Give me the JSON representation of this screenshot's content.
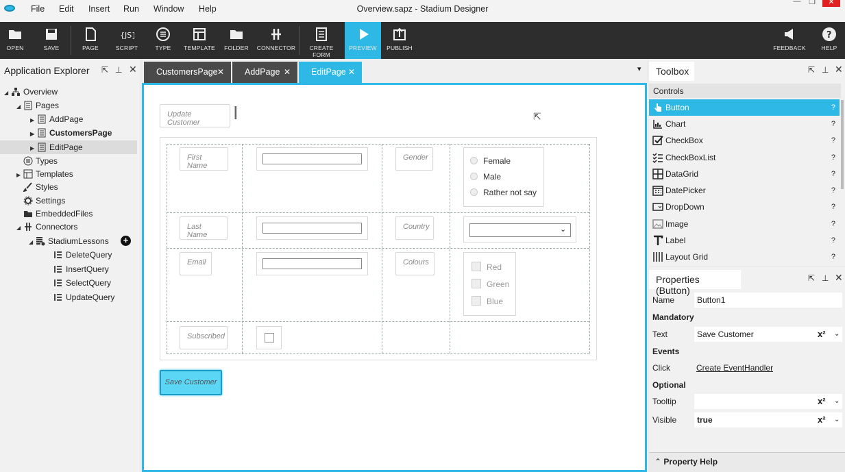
{
  "window": {
    "title": "Overview.sapz - Stadium Designer",
    "menu": [
      "File",
      "Edit",
      "Insert",
      "Run",
      "Window",
      "Help"
    ]
  },
  "toolbar": {
    "open": "OPEN",
    "save": "SAVE",
    "page": "PAGE",
    "script": "SCRIPT",
    "type": "TYPE",
    "template": "TEMPLATE",
    "folder": "FOLDER",
    "connector": "CONNECTOR",
    "create_form": "CREATE FORM",
    "preview": "PREVIEW",
    "publish": "PUBLISH",
    "feedback": "FEEDBACK",
    "help": "HELP"
  },
  "explorer": {
    "title": "Application Explorer",
    "items": {
      "overview": "Overview",
      "pages": "Pages",
      "addpage": "AddPage",
      "customerspage": "CustomersPage",
      "editpage": "EditPage",
      "types": "Types",
      "templates": "Templates",
      "styles": "Styles",
      "settings": "Settings",
      "embedded": "EmbeddedFiles",
      "connectors": "Connectors",
      "lessons": "StadiumLessons",
      "delete": "DeleteQuery",
      "insert": "InsertQuery",
      "select": "SelectQuery",
      "update": "UpdateQuery"
    }
  },
  "tabs": [
    "CustomersPage",
    "AddPage",
    "EditPage"
  ],
  "form": {
    "heading": "Update Customer",
    "first_name": "First Name",
    "gender": "Gender",
    "female": "Female",
    "male": "Male",
    "rather_not": "Rather not say",
    "last_name": "Last Name",
    "country": "Country",
    "email": "Email",
    "colours": "Colours",
    "red": "Red",
    "green": "Green",
    "blue": "Blue",
    "subscribed": "Subscribed",
    "save_button": "Save Customer"
  },
  "toolbox": {
    "title": "Toolbox",
    "section": "Controls",
    "items": [
      "Button",
      "Chart",
      "CheckBox",
      "CheckBoxList",
      "DataGrid",
      "DatePicker",
      "DropDown",
      "Image",
      "Label",
      "Layout Grid"
    ],
    "help": "?"
  },
  "properties": {
    "title": "Properties (Button)",
    "name_label": "Name",
    "name_value": "Button1",
    "mandatory": "Mandatory",
    "text_label": "Text",
    "text_value": "Save Customer",
    "events": "Events",
    "click_label": "Click",
    "click_value": "Create EventHandler",
    "optional": "Optional",
    "tooltip_label": "Tooltip",
    "tooltip_value": "",
    "visible_label": "Visible",
    "visible_value": "true",
    "help": "Property Help"
  },
  "colors": {
    "accent": "#2eb8e6",
    "toolbar": "#2d2d2d"
  }
}
